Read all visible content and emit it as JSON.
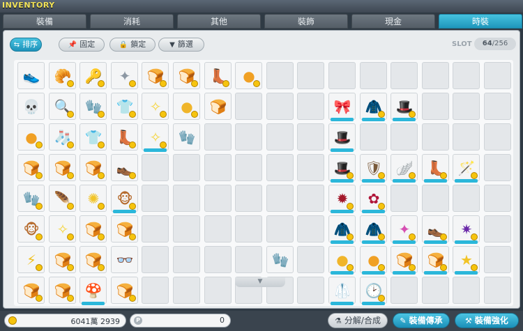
{
  "window": {
    "title": "INVENTORY"
  },
  "tabs": [
    {
      "label": "裝備",
      "active": false
    },
    {
      "label": "消耗",
      "active": false
    },
    {
      "label": "其他",
      "active": false
    },
    {
      "label": "裝飾",
      "active": false
    },
    {
      "label": "現金",
      "active": false
    },
    {
      "label": "時裝",
      "active": true
    }
  ],
  "toolbar": {
    "sort_label": "排序",
    "fix_label": "固定",
    "lock_label": "鎖定",
    "filter_label": "篩選",
    "slot_label": "SLOT",
    "slot_used": "64",
    "slot_total": "/256"
  },
  "grid": {
    "columns": 16,
    "rows": 8,
    "items": [
      {
        "row": 0,
        "col": 0,
        "icon": "red-sneaker-icon",
        "glyph": "👟",
        "color": "#c03a2b",
        "badge": false,
        "bar": false
      },
      {
        "row": 0,
        "col": 1,
        "icon": "bread-icon",
        "glyph": "🥐",
        "color": "#e39a3b",
        "badge": true,
        "bar": false
      },
      {
        "row": 0,
        "col": 2,
        "icon": "keyring-icon",
        "glyph": "🔑",
        "color": "#9a8a6a",
        "badge": true,
        "bar": false
      },
      {
        "row": 0,
        "col": 3,
        "icon": "wing-ornament-icon",
        "glyph": "✦",
        "color": "#8c97a3",
        "badge": true,
        "bar": false
      },
      {
        "row": 0,
        "col": 4,
        "icon": "bread-icon",
        "glyph": "🍞",
        "color": "#e0a13f",
        "badge": true,
        "bar": false
      },
      {
        "row": 0,
        "col": 5,
        "icon": "bread-icon",
        "glyph": "🍞",
        "color": "#e0a13f",
        "badge": true,
        "bar": false
      },
      {
        "row": 0,
        "col": 6,
        "icon": "brown-boot-icon",
        "glyph": "👢",
        "color": "#5b3a22",
        "badge": true,
        "bar": false
      },
      {
        "row": 0,
        "col": 7,
        "icon": "orange-bun-icon",
        "glyph": "●",
        "color": "#f0a024",
        "badge": true,
        "bar": false
      },
      {
        "row": 1,
        "col": 0,
        "icon": "skull-icon",
        "glyph": "💀",
        "color": "#8fb2c9",
        "badge": false,
        "bar": false
      },
      {
        "row": 1,
        "col": 1,
        "icon": "magnifier-icon",
        "glyph": "🔍",
        "color": "#6f8ca3",
        "badge": true,
        "bar": false
      },
      {
        "row": 1,
        "col": 2,
        "icon": "glove-icon",
        "glyph": "🧤",
        "color": "#8da3b6",
        "badge": true,
        "bar": false
      },
      {
        "row": 1,
        "col": 3,
        "icon": "white-shirt-icon",
        "glyph": "👕",
        "color": "#d9dde0",
        "badge": true,
        "bar": false
      },
      {
        "row": 1,
        "col": 4,
        "icon": "sparkle-icon",
        "glyph": "✧",
        "color": "#f5d43a",
        "badge": true,
        "bar": false
      },
      {
        "row": 1,
        "col": 5,
        "icon": "orange-bun-icon",
        "glyph": "●",
        "color": "#f0b52a",
        "badge": true,
        "bar": false
      },
      {
        "row": 1,
        "col": 6,
        "icon": "twin-bun-icon",
        "glyph": "🍞",
        "color": "#e5a140",
        "badge": false,
        "bar": false
      },
      {
        "row": 1,
        "col": 10,
        "icon": "purple-ribbon-icon",
        "glyph": "🎀",
        "color": "#7a3a9e",
        "badge": false,
        "bar": true
      },
      {
        "row": 1,
        "col": 11,
        "icon": "dark-outfit-icon",
        "glyph": "🧥",
        "color": "#6a3030",
        "badge": true,
        "bar": true
      },
      {
        "row": 1,
        "col": 12,
        "icon": "purple-hat-icon",
        "glyph": "🎩",
        "color": "#6a3c8f",
        "badge": true,
        "bar": true
      },
      {
        "row": 2,
        "col": 0,
        "icon": "orange-bun-icon",
        "glyph": "●",
        "color": "#f0a024",
        "badge": true,
        "bar": false
      },
      {
        "row": 2,
        "col": 1,
        "icon": "sock-icon",
        "glyph": "🧦",
        "color": "#d8d2c2",
        "badge": true,
        "bar": false
      },
      {
        "row": 2,
        "col": 2,
        "icon": "tshirt-icon",
        "glyph": "👕",
        "color": "#e3e5e7",
        "badge": true,
        "bar": false
      },
      {
        "row": 2,
        "col": 3,
        "icon": "white-boot-icon",
        "glyph": "👢",
        "color": "#c9d3dd",
        "badge": true,
        "bar": false
      },
      {
        "row": 2,
        "col": 4,
        "icon": "sparkle-icon",
        "glyph": "✧",
        "color": "#f5d43a",
        "badge": true,
        "bar": true
      },
      {
        "row": 2,
        "col": 5,
        "icon": "white-glove-icon",
        "glyph": "🧤",
        "color": "#dfe6ee",
        "badge": false,
        "bar": false
      },
      {
        "row": 2,
        "col": 10,
        "icon": "black-hat-icon",
        "glyph": "🎩",
        "color": "#2a2a2a",
        "badge": false,
        "bar": true
      },
      {
        "row": 3,
        "col": 0,
        "icon": "bread-icon",
        "glyph": "🍞",
        "color": "#e0a13f",
        "badge": true,
        "bar": false
      },
      {
        "row": 3,
        "col": 1,
        "icon": "bread-icon",
        "glyph": "🍞",
        "color": "#e0a13f",
        "badge": true,
        "bar": false
      },
      {
        "row": 3,
        "col": 2,
        "icon": "bread-icon",
        "glyph": "🍞",
        "color": "#e0a13f",
        "badge": true,
        "bar": false
      },
      {
        "row": 3,
        "col": 3,
        "icon": "grey-shoe-icon",
        "glyph": "👞",
        "color": "#8e949a",
        "badge": true,
        "bar": false
      },
      {
        "row": 3,
        "col": 10,
        "icon": "pirate-hat-icon",
        "glyph": "🎩",
        "color": "#3c2c1e",
        "badge": true,
        "bar": true
      },
      {
        "row": 3,
        "col": 11,
        "icon": "armor-icon",
        "glyph": "🛡",
        "color": "#7a5a3a",
        "badge": true,
        "bar": true
      },
      {
        "row": 3,
        "col": 12,
        "icon": "golden-wings-icon",
        "glyph": "🪽",
        "color": "#c9962c",
        "badge": true,
        "bar": true
      },
      {
        "row": 3,
        "col": 13,
        "icon": "black-boot-icon",
        "glyph": "👢",
        "color": "#222",
        "badge": true,
        "bar": true
      },
      {
        "row": 3,
        "col": 14,
        "icon": "staff-icon",
        "glyph": "🪄",
        "color": "#7a3a3a",
        "badge": true,
        "bar": true
      },
      {
        "row": 4,
        "col": 0,
        "icon": "white-glove-icon",
        "glyph": "🧤",
        "color": "#dfe6ee",
        "badge": true,
        "bar": false
      },
      {
        "row": 4,
        "col": 1,
        "icon": "feather-icon",
        "glyph": "🪶",
        "color": "#c9ced3",
        "badge": true,
        "bar": false
      },
      {
        "row": 4,
        "col": 2,
        "icon": "golden-glow-icon",
        "glyph": "✺",
        "color": "#f2c427",
        "badge": true,
        "bar": false
      },
      {
        "row": 4,
        "col": 3,
        "icon": "monkey-icon",
        "glyph": "🐵",
        "color": "#b56a2c",
        "badge": true,
        "bar": true
      },
      {
        "row": 4,
        "col": 10,
        "icon": "red-aura-icon",
        "glyph": "✹",
        "color": "#a3182a",
        "badge": true,
        "bar": true
      },
      {
        "row": 4,
        "col": 11,
        "icon": "red-flower-icon",
        "glyph": "✿",
        "color": "#b0163a",
        "badge": true,
        "bar": true
      },
      {
        "row": 5,
        "col": 0,
        "icon": "monkey-icon",
        "glyph": "🐵",
        "color": "#b56a2c",
        "badge": true,
        "bar": false
      },
      {
        "row": 5,
        "col": 1,
        "icon": "sparkle-icon",
        "glyph": "✧",
        "color": "#f5d43a",
        "badge": true,
        "bar": false
      },
      {
        "row": 5,
        "col": 2,
        "icon": "twin-bun-icon",
        "glyph": "🍞",
        "color": "#e5a140",
        "badge": true,
        "bar": false
      },
      {
        "row": 5,
        "col": 3,
        "icon": "twin-bun-icon",
        "glyph": "🍞",
        "color": "#e5a140",
        "badge": true,
        "bar": false
      },
      {
        "row": 5,
        "col": 10,
        "icon": "dark-cloak-icon",
        "glyph": "🧥",
        "color": "#2b1a1a",
        "badge": true,
        "bar": true
      },
      {
        "row": 5,
        "col": 11,
        "icon": "dark-cloak-icon",
        "glyph": "🧥",
        "color": "#24160f",
        "badge": true,
        "bar": true
      },
      {
        "row": 5,
        "col": 12,
        "icon": "pink-crystal-icon",
        "glyph": "✦",
        "color": "#d64fb3",
        "badge": true,
        "bar": true
      },
      {
        "row": 5,
        "col": 13,
        "icon": "black-shoe-icon",
        "glyph": "👞",
        "color": "#1e1e1e",
        "badge": true,
        "bar": true
      },
      {
        "row": 5,
        "col": 14,
        "icon": "purple-aura-icon",
        "glyph": "✷",
        "color": "#6a28a8",
        "badge": true,
        "bar": true
      },
      {
        "row": 6,
        "col": 0,
        "icon": "lightning-sword-icon",
        "glyph": "⚡",
        "color": "#f0c020",
        "badge": true,
        "bar": false
      },
      {
        "row": 6,
        "col": 1,
        "icon": "bread-icon",
        "glyph": "🍞",
        "color": "#e0a13f",
        "badge": true,
        "bar": false
      },
      {
        "row": 6,
        "col": 2,
        "icon": "bread-icon",
        "glyph": "🍞",
        "color": "#e0a13f",
        "badge": true,
        "bar": false
      },
      {
        "row": 6,
        "col": 3,
        "icon": "glasses-icon",
        "glyph": "👓",
        "color": "#444",
        "badge": false,
        "bar": false
      },
      {
        "row": 6,
        "col": 8,
        "icon": "white-glove-icon",
        "glyph": "🧤",
        "color": "#dfe6ee",
        "badge": false,
        "bar": false
      },
      {
        "row": 6,
        "col": 10,
        "icon": "orange-bun-icon",
        "glyph": "●",
        "color": "#f0b52a",
        "badge": true,
        "bar": true
      },
      {
        "row": 6,
        "col": 11,
        "icon": "orange-bun-icon",
        "glyph": "●",
        "color": "#f0a024",
        "badge": true,
        "bar": true
      },
      {
        "row": 6,
        "col": 12,
        "icon": "twin-bun-icon",
        "glyph": "🍞",
        "color": "#e5a140",
        "badge": true,
        "bar": true
      },
      {
        "row": 6,
        "col": 13,
        "icon": "bread-icon",
        "glyph": "🍞",
        "color": "#e0a13f",
        "badge": true,
        "bar": true
      },
      {
        "row": 6,
        "col": 14,
        "icon": "rainbow-star-icon",
        "glyph": "★",
        "color": "#f2c427",
        "badge": true,
        "bar": true
      },
      {
        "row": 7,
        "col": 0,
        "icon": "twin-bun-icon",
        "glyph": "🍞",
        "color": "#e5a140",
        "badge": true,
        "bar": false
      },
      {
        "row": 7,
        "col": 1,
        "icon": "bread-icon",
        "glyph": "🍞",
        "color": "#e0a13f",
        "badge": true,
        "bar": false
      },
      {
        "row": 7,
        "col": 2,
        "icon": "red-mushroom-icon",
        "glyph": "🍄",
        "color": "#c8202a",
        "badge": false,
        "bar": true
      },
      {
        "row": 7,
        "col": 3,
        "icon": "twin-bun-icon",
        "glyph": "🍞",
        "color": "#e5a140",
        "badge": true,
        "bar": false
      },
      {
        "row": 7,
        "col": 10,
        "icon": "white-robe-icon",
        "glyph": "🥼",
        "color": "#e0e0e0",
        "badge": false,
        "bar": true
      },
      {
        "row": 7,
        "col": 11,
        "icon": "clock-icon",
        "glyph": "🕑",
        "color": "#3a4a7a",
        "badge": true,
        "bar": true
      }
    ]
  },
  "footer": {
    "meso_amount": "6041萬  2939",
    "points_label": "P",
    "points_amount": "0",
    "disassemble_label": "分解/合成",
    "inherit_label": "裝備傳承",
    "enhance_label": "裝備強化"
  }
}
